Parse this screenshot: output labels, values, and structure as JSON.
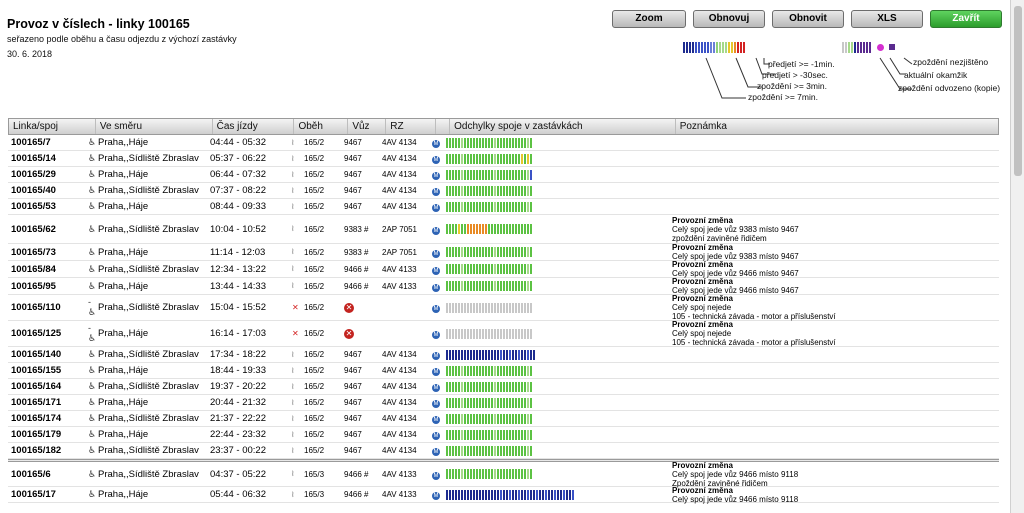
{
  "header": {
    "title": "Provoz v číslech - linky 100165",
    "subtitle": "seřazeno podle oběhu a času odjezdu z výchozí zastávky",
    "date": "30. 6. 2018"
  },
  "buttons": {
    "zoom": "Zoom",
    "obnovuj": "Obnovuj",
    "obnovit": "Obnovit",
    "xls": "XLS",
    "zavrit": "Zavřít"
  },
  "legend": {
    "predjeti_1": "předjetí >= -1min.",
    "predjeti_30": "předjetí > -30sec.",
    "zpozdeni_3": "zpoždění >= 3min.",
    "zpozdeni_7": "zpoždění >= 7min.",
    "nezjisteno": "zpoždění nezjištěno",
    "aktualni": "aktuální okamžik",
    "odvozeno": "zpoždění odvozeno (kopie)"
  },
  "table": {
    "headers": [
      "Linka/spoj",
      "Ve směru",
      "Čas jízdy",
      "Oběh",
      "Vůz",
      "RZ",
      "Odchylky spoje v zastávkách",
      "Poznámka"
    ],
    "rows": [
      {
        "linka": "100165/7",
        "smer": "Praha,,Háje",
        "cas": "04:44 - 05:32",
        "obeh": "165/2",
        "vuz": "9467",
        "rz": "4AV 4134",
        "pozn1": "",
        "pozn2": "",
        "pozn3": ""
      },
      {
        "linka": "100165/14",
        "smer": "Praha,,Sídliště Zbraslav",
        "cas": "05:37 - 06:22",
        "obeh": "165/2",
        "vuz": "9467",
        "rz": "4AV 4134",
        "pozn1": "",
        "pozn2": "",
        "pozn3": ""
      },
      {
        "linka": "100165/29",
        "smer": "Praha,,Háje",
        "cas": "06:44 - 07:32",
        "obeh": "165/2",
        "vuz": "9467",
        "rz": "4AV 4134",
        "pozn1": "",
        "pozn2": "",
        "pozn3": ""
      },
      {
        "linka": "100165/40",
        "smer": "Praha,,Sídliště Zbraslav",
        "cas": "07:37 - 08:22",
        "obeh": "165/2",
        "vuz": "9467",
        "rz": "4AV 4134",
        "pozn1": "",
        "pozn2": "",
        "pozn3": ""
      },
      {
        "linka": "100165/53",
        "smer": "Praha,,Háje",
        "cas": "08:44 - 09:33",
        "obeh": "165/2",
        "vuz": "9467",
        "rz": "4AV 4134",
        "pozn1": "",
        "pozn2": "",
        "pozn3": ""
      },
      {
        "linka": "100165/62",
        "smer": "Praha,,Sídliště Zbraslav",
        "cas": "10:04 - 10:52",
        "obeh": "165/2",
        "vuz": "9383 #",
        "rz": "2AP 7051",
        "pozn1": "Provozní změna",
        "pozn2": "Celý spoj jede vůz 9383 místo 9467",
        "pozn3": "zpoždění zaviněné řidičem"
      },
      {
        "linka": "100165/73",
        "smer": "Praha,,Háje",
        "cas": "11:14 - 12:03",
        "obeh": "165/2",
        "vuz": "9383 #",
        "rz": "2AP 7051",
        "pozn1": "Provozní změna",
        "pozn2": "Celý spoj jede vůz 9383 místo 9467",
        "pozn3": ""
      },
      {
        "linka": "100165/84",
        "smer": "Praha,,Sídliště Zbraslav",
        "cas": "12:34 - 13:22",
        "obeh": "165/2",
        "vuz": "9466 #",
        "rz": "4AV 4133",
        "pozn1": "Provozní změna",
        "pozn2": "Celý spoj jede vůz 9466 místo 9467",
        "pozn3": ""
      },
      {
        "linka": "100165/95",
        "smer": "Praha,,Háje",
        "cas": "13:44 - 14:33",
        "obeh": "165/2",
        "vuz": "9466 #",
        "rz": "4AV 4133",
        "pozn1": "Provozní změna",
        "pozn2": "Celý spoj jede vůz 9466 místo 9467",
        "pozn3": ""
      },
      {
        "linka": "100165/110",
        "smer": "Praha,,Sídliště Zbraslav",
        "cas": "15:04 - 15:52",
        "obeh": "165/2",
        "vuz": "",
        "rz": "",
        "pozn1": "Provozní změna",
        "pozn2": "Celý spoj nejede",
        "pozn3": "105 - technická závada - motor a příslušenství"
      },
      {
        "linka": "100165/125",
        "smer": "Praha,,Háje",
        "cas": "16:14 - 17:03",
        "obeh": "165/2",
        "vuz": "",
        "rz": "",
        "pozn1": "Provozní změna",
        "pozn2": "Celý spoj nejede",
        "pozn3": "105 - technická závada - motor a příslušenství"
      },
      {
        "linka": "100165/140",
        "smer": "Praha,,Sídliště Zbraslav",
        "cas": "17:34 - 18:22",
        "obeh": "165/2",
        "vuz": "9467",
        "rz": "4AV 4134",
        "pozn1": "",
        "pozn2": "",
        "pozn3": ""
      },
      {
        "linka": "100165/155",
        "smer": "Praha,,Háje",
        "cas": "18:44 - 19:33",
        "obeh": "165/2",
        "vuz": "9467",
        "rz": "4AV 4134",
        "pozn1": "",
        "pozn2": "",
        "pozn3": ""
      },
      {
        "linka": "100165/164",
        "smer": "Praha,,Sídliště Zbraslav",
        "cas": "19:37 - 20:22",
        "obeh": "165/2",
        "vuz": "9467",
        "rz": "4AV 4134",
        "pozn1": "",
        "pozn2": "",
        "pozn3": ""
      },
      {
        "linka": "100165/171",
        "smer": "Praha,,Háje",
        "cas": "20:44 - 21:32",
        "obeh": "165/2",
        "vuz": "9467",
        "rz": "4AV 4134",
        "pozn1": "",
        "pozn2": "",
        "pozn3": ""
      },
      {
        "linka": "100165/174",
        "smer": "Praha,,Sídliště Zbraslav",
        "cas": "21:37 - 22:22",
        "obeh": "165/2",
        "vuz": "9467",
        "rz": "4AV 4134",
        "pozn1": "",
        "pozn2": "",
        "pozn3": ""
      },
      {
        "linka": "100165/179",
        "smer": "Praha,,Háje",
        "cas": "22:44 - 23:32",
        "obeh": "165/2",
        "vuz": "9467",
        "rz": "4AV 4134",
        "pozn1": "",
        "pozn2": "",
        "pozn3": ""
      },
      {
        "linka": "100165/182",
        "smer": "Praha,,Sídliště Zbraslav",
        "cas": "23:37 - 00:22",
        "obeh": "165/2",
        "vuz": "9467",
        "rz": "4AV 4134",
        "pozn1": "",
        "pozn2": "",
        "pozn3": ""
      },
      {
        "linka": "100165/6",
        "smer": "Praha,,Sídliště Zbraslav",
        "cas": "04:37 - 05:22",
        "obeh": "165/3",
        "vuz": "9466 #",
        "rz": "4AV 4133",
        "pozn1": "Provozní změna",
        "pozn2": "Celý spoj jede vůz 9466 místo 9118",
        "pozn3": "Zpoždění zaviněné řidičem"
      },
      {
        "linka": "100165/17",
        "smer": "Praha,,Háje",
        "cas": "05:44 - 06:32",
        "obeh": "165/3",
        "vuz": "9466 #",
        "rz": "4AV 4133",
        "pozn1": "Provozní změna",
        "pozn2": "Celý spoj jede vůz 9466 místo 9118",
        "pozn3": ""
      }
    ]
  },
  "colors": {
    "green": "#5cc243",
    "lightgreen": "#a5d98a",
    "darkblue": "#1d2b8f",
    "blue": "#3a52c6",
    "yellow": "#e6c72c",
    "orange": "#e88a24",
    "red": "#d32222",
    "gray": "#c8c8c8",
    "purple": "#5a2a8f",
    "magenta": "#d42fd0",
    "accent_button": "#3aaa3a",
    "cancel_icon": "#c3231f",
    "map_icon": "#2d63b5"
  },
  "icons": {
    "wheelchair": "wheelchair-icon",
    "wheelchair_partial": "wheelchair-partial-icon",
    "signal": "signal-icon",
    "signal_off": "signal-off-icon",
    "cancel": "cancel-icon",
    "map": "map-icon"
  }
}
